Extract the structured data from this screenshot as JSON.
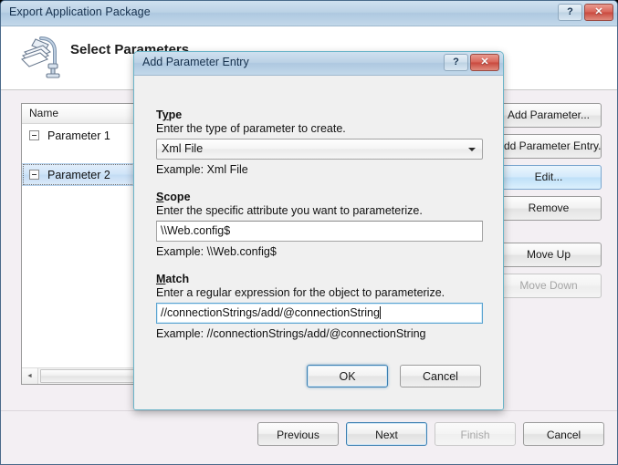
{
  "main_window": {
    "title": "Export Application Package",
    "titlebar_buttons": [
      {
        "name": "help-button",
        "glyph": "?"
      },
      {
        "name": "close-button",
        "glyph": "✕"
      }
    ],
    "header": {
      "icon": "package-clamp-icon",
      "title": "Select Parameters"
    },
    "listview": {
      "columns": [
        "Name"
      ],
      "rows": [
        {
          "label": "Parameter 1",
          "selected": false,
          "expander": "collapse-box"
        },
        {
          "label": "Parameter 2",
          "selected": true,
          "expander": "collapse-box"
        }
      ],
      "hscrollbar": {
        "left_arrow": "◄",
        "right_arrow": "►"
      }
    },
    "side_buttons": [
      {
        "label": "Add Parameter...",
        "state": "normal",
        "name": "add-parameter-button"
      },
      {
        "label": "Add Parameter Entry...",
        "state": "normal",
        "name": "add-parameter-entry-button"
      },
      {
        "label": "Edit...",
        "state": "hover",
        "name": "edit-button"
      },
      {
        "label": "Remove",
        "state": "normal",
        "name": "remove-button"
      },
      {
        "label": "Move Up",
        "state": "normal",
        "name": "move-up-button"
      },
      {
        "label": "Move Down",
        "state": "disabled",
        "name": "move-down-button"
      }
    ],
    "footer_buttons": [
      {
        "label": "Previous",
        "state": "normal",
        "name": "previous-button"
      },
      {
        "label": "Next",
        "state": "default",
        "name": "next-button"
      },
      {
        "label": "Finish",
        "state": "disabled",
        "name": "finish-button"
      },
      {
        "label": "Cancel",
        "state": "normal",
        "name": "cancel-button"
      }
    ]
  },
  "dialog": {
    "title": "Add Parameter Entry",
    "titlebar_buttons": [
      {
        "name": "dialog-help-button",
        "glyph": "?"
      },
      {
        "name": "dialog-close-button",
        "glyph": "✕"
      }
    ],
    "fields": {
      "type": {
        "label_prefix": "T",
        "label_accel": "y",
        "label_suffix": "pe",
        "description": "Enter the type of parameter to create.",
        "value": "Xml File",
        "example": "Example: Xml File"
      },
      "scope": {
        "label_accel": "S",
        "label_suffix": "cope",
        "description": "Enter the specific attribute you want to parameterize.",
        "value": "\\\\Web.config$",
        "example": "Example: \\\\Web.config$"
      },
      "match": {
        "label_accel": "M",
        "label_suffix": "atch",
        "description": "Enter a regular expression for the object to parameterize.",
        "value": "//connectionStrings/add/@connectionString",
        "example": "Example: //connectionStrings/add/@connectionString"
      }
    },
    "buttons": [
      {
        "label": "OK",
        "state": "default",
        "name": "dialog-ok-button"
      },
      {
        "label": "Cancel",
        "state": "normal",
        "name": "dialog-cancel-button"
      }
    ]
  },
  "colors": {
    "titlebar": "#bcd2e6",
    "dialog_border": "#6ab4c8",
    "selection": "#cfe4f8",
    "hover": "#d4eafb",
    "close_button": "#c9493e",
    "window_background": "#f3eff3",
    "dialog_background": "#f0f0f0"
  }
}
